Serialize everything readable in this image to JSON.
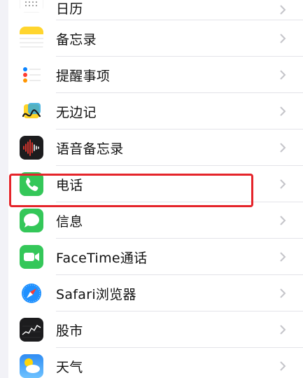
{
  "settings_list": {
    "items": [
      {
        "label": "日历",
        "icon": "calendar-icon"
      },
      {
        "label": "备忘录",
        "icon": "notes-icon"
      },
      {
        "label": "提醒事项",
        "icon": "reminders-icon"
      },
      {
        "label": "无边记",
        "icon": "freeform-icon"
      },
      {
        "label": "语音备忘录",
        "icon": "voice-memos-icon"
      },
      {
        "label": "电话",
        "icon": "phone-icon"
      },
      {
        "label": "信息",
        "icon": "messages-icon"
      },
      {
        "label": "FaceTime通话",
        "icon": "facetime-icon"
      },
      {
        "label": "Safari浏览器",
        "icon": "safari-icon"
      },
      {
        "label": "股市",
        "icon": "stocks-icon"
      },
      {
        "label": "天气",
        "icon": "weather-icon"
      }
    ]
  },
  "highlight": {
    "target": "电话",
    "color": "#e5242a"
  }
}
